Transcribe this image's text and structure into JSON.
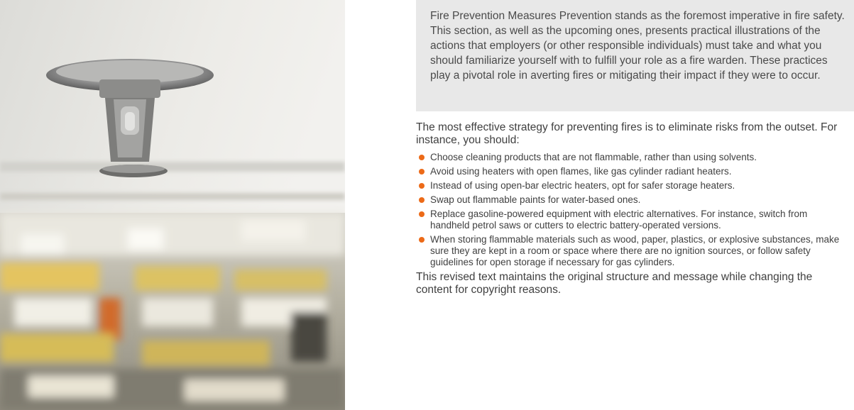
{
  "intro": {
    "text": "Fire Prevention Measures Prevention stands as the foremost imperative in fire safety. This section, as well as the upcoming ones, presents practical illustrations of the actions that employers (or other responsible individuals) must take and what you should familiarize yourself with to fulfill your role as a fire warden. These practices play a pivotal role in averting fires or mitigating their impact if they were to occur."
  },
  "body": {
    "lead": "The most effective strategy for preventing fires is to eliminate risks from the outset. For instance, you should:",
    "bullets": [
      "Choose cleaning products that are not flammable, rather than using solvents.",
      "Avoid using heaters with open flames, like gas cylinder radiant heaters.",
      "Instead of using open-bar electric heaters, opt for safer storage heaters.",
      "Swap out flammable paints for water-based ones.",
      "Replace gasoline-powered equipment with electric alternatives. For instance, switch from handheld petrol saws or cutters to electric battery-operated versions.",
      "When storing flammable materials such as wood, paper, plastics, or explosive substances, make sure they are kept in a room or space where there are no ignition sources, or follow safety guidelines for open storage if necessary for gas cylinders."
    ],
    "closing": "This revised text maintains the original structure and message while changing the content for copyright reasons."
  },
  "photo": {
    "icon": "sprinkler-office-photo"
  },
  "colors": {
    "bullet": "#ec6a18",
    "intro_bg": "#e8e8e8",
    "text": "#404040"
  }
}
